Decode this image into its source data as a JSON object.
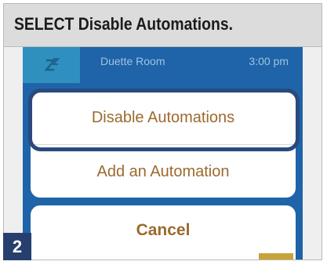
{
  "instruction": {
    "text": "SELECT Disable Automations."
  },
  "background_row": {
    "icon": "zz-sleep-icon",
    "name": "Duette Room",
    "time": "3:00 pm"
  },
  "action_sheet": {
    "items": [
      {
        "label": "Disable Automations",
        "highlighted": true
      },
      {
        "label": "Add an Automation",
        "highlighted": false
      }
    ],
    "cancel_label": "Cancel"
  },
  "step_badge": {
    "number": "2"
  },
  "colors": {
    "highlight": "#2a4a7c",
    "action_text": "#9b6a2d",
    "row_background": "#1f63a8",
    "badge": "#263f6e"
  }
}
